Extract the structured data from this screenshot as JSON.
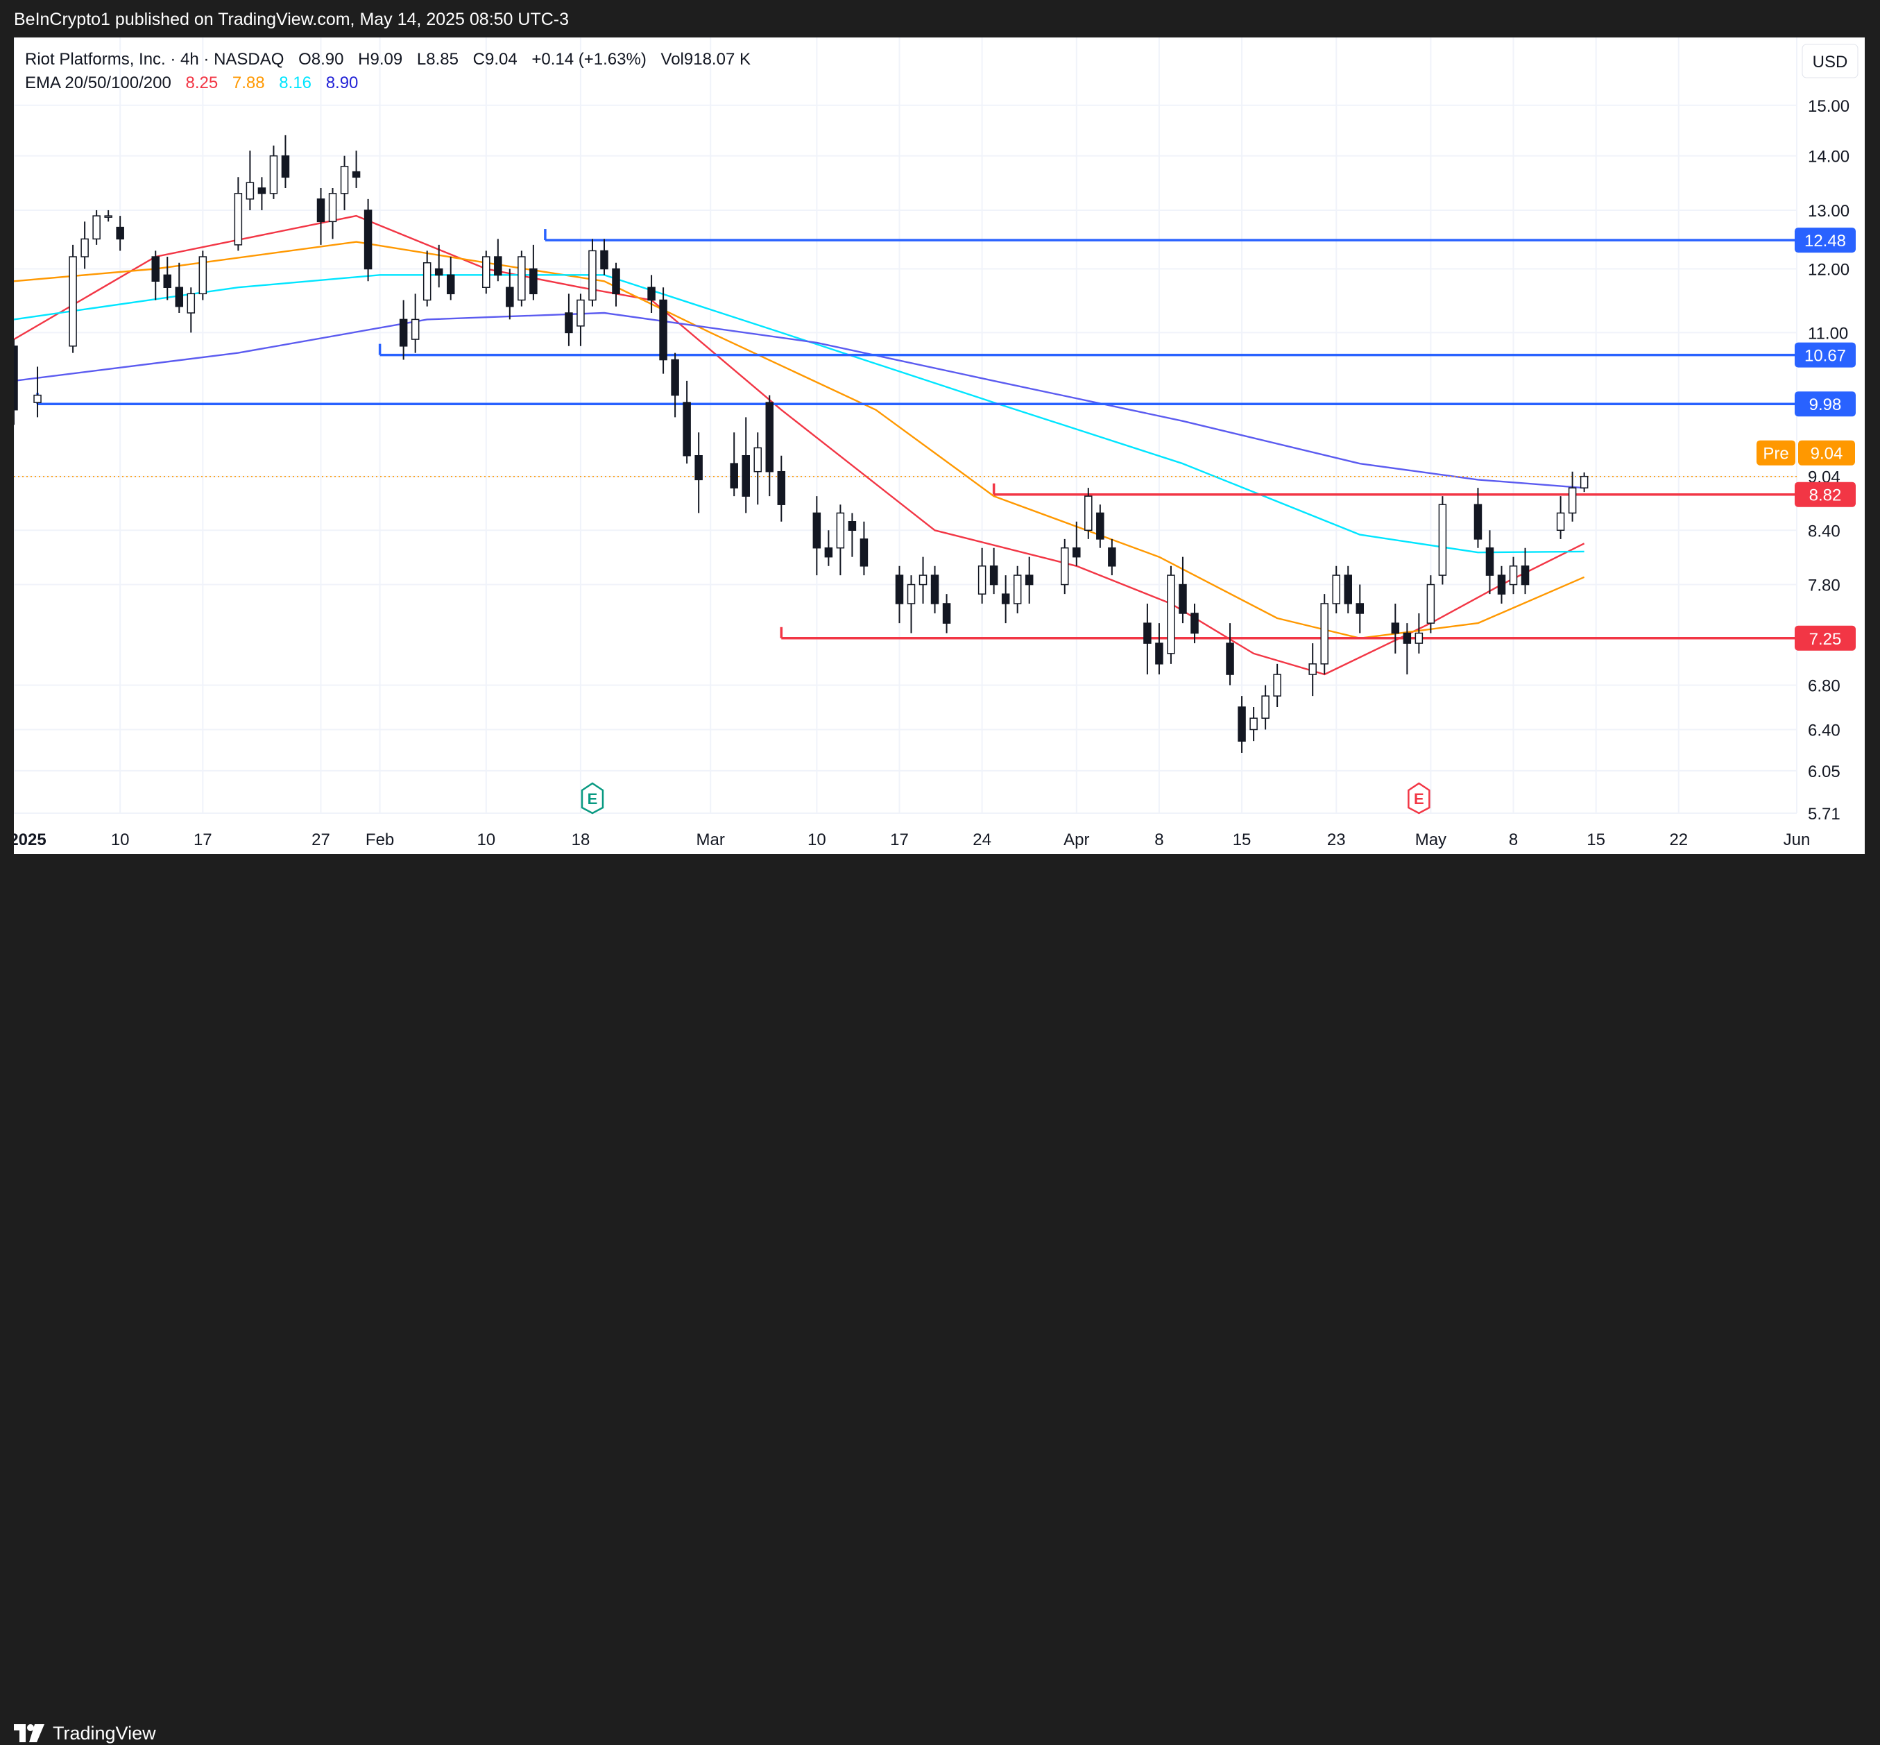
{
  "header": {
    "publisher": "BeInCrypto1 published on TradingView.com, May 14, 2025 08:50 UTC-3"
  },
  "footer": {
    "brand": "TradingView"
  },
  "chart_data": {
    "type": "candlestick",
    "symbol": {
      "name": "Riot Platforms, Inc. · 4h · NASDAQ",
      "open_label": "O",
      "open": "8.90",
      "high_label": "H",
      "high": "9.09",
      "low_label": "L",
      "low": "8.85",
      "close_label": "C",
      "close": "9.04",
      "change": "+0.14 (+1.63%)",
      "volume_label": "Vol",
      "volume": "918.07 K"
    },
    "ema_legend": {
      "label": "EMA 20/50/100/200",
      "values": [
        {
          "value": "8.25",
          "color": "#f23645"
        },
        {
          "value": "7.88",
          "color": "#ff9800"
        },
        {
          "value": "8.16",
          "color": "#00e5ff"
        },
        {
          "value": "8.90",
          "color": "#2323d6"
        }
      ]
    },
    "currency": "USD",
    "y_ticks": [
      "15.00",
      "14.00",
      "13.00",
      "12.00",
      "11.00",
      "9.04",
      "8.40",
      "7.80",
      "6.80",
      "6.40",
      "6.05",
      "5.71"
    ],
    "x_ticks": [
      "2025",
      "10",
      "17",
      "27",
      "Feb",
      "10",
      "18",
      "Mar",
      "10",
      "17",
      "24",
      "Apr",
      "8",
      "15",
      "23",
      "May",
      "8",
      "15",
      "22",
      "Jun"
    ],
    "x_range": [
      "2025-01-01",
      "2025-06-01"
    ],
    "y_range": [
      5.71,
      15.4
    ],
    "y_scale": "log",
    "pre_market": {
      "label": "Pre",
      "value": "9.04",
      "color": "#ff9800"
    },
    "levels": [
      {
        "value": 12.48,
        "label": "12.48",
        "color": "#2962ff",
        "from": "2025-02-15"
      },
      {
        "value": 10.67,
        "label": "10.67",
        "color": "#2962ff",
        "from": "2025-02-01"
      },
      {
        "value": 9.98,
        "label": "9.98",
        "color": "#2962ff",
        "from": "2025-01-03"
      },
      {
        "value": 8.82,
        "label": "8.82",
        "color": "#f23645",
        "from": "2025-03-25"
      },
      {
        "value": 7.25,
        "label": "7.25",
        "color": "#f23645",
        "from": "2025-03-07"
      }
    ],
    "earnings_markers": [
      {
        "date": "2025-02-19",
        "label": "E",
        "color": "#089981"
      },
      {
        "date": "2025-04-30",
        "label": "E",
        "color": "#f23645"
      }
    ],
    "candles": [
      {
        "d": "2025-01-01",
        "o": 10.8,
        "h": 10.9,
        "l": 9.7,
        "c": 9.9
      },
      {
        "d": "2025-01-03",
        "o": 10.0,
        "h": 10.5,
        "l": 9.8,
        "c": 10.1
      },
      {
        "d": "2025-01-06",
        "o": 10.8,
        "h": 12.4,
        "l": 10.7,
        "c": 12.2
      },
      {
        "d": "2025-01-07",
        "o": 12.2,
        "h": 12.8,
        "l": 12.0,
        "c": 12.5
      },
      {
        "d": "2025-01-08",
        "o": 12.5,
        "h": 13.0,
        "l": 12.4,
        "c": 12.9
      },
      {
        "d": "2025-01-09",
        "o": 12.9,
        "h": 13.0,
        "l": 12.8,
        "c": 12.9
      },
      {
        "d": "2025-01-10",
        "o": 12.7,
        "h": 12.9,
        "l": 12.3,
        "c": 12.5
      },
      {
        "d": "2025-01-13",
        "o": 12.2,
        "h": 12.3,
        "l": 11.5,
        "c": 11.8
      },
      {
        "d": "2025-01-14",
        "o": 11.9,
        "h": 12.2,
        "l": 11.5,
        "c": 11.7
      },
      {
        "d": "2025-01-15",
        "o": 11.7,
        "h": 12.1,
        "l": 11.3,
        "c": 11.4
      },
      {
        "d": "2025-01-16",
        "o": 11.3,
        "h": 11.7,
        "l": 11.0,
        "c": 11.6
      },
      {
        "d": "2025-01-17",
        "o": 11.6,
        "h": 12.3,
        "l": 11.5,
        "c": 12.2
      },
      {
        "d": "2025-01-20",
        "o": 12.4,
        "h": 13.6,
        "l": 12.3,
        "c": 13.3
      },
      {
        "d": "2025-01-21",
        "o": 13.2,
        "h": 14.1,
        "l": 13.0,
        "c": 13.5
      },
      {
        "d": "2025-01-22",
        "o": 13.4,
        "h": 13.6,
        "l": 13.0,
        "c": 13.3
      },
      {
        "d": "2025-01-23",
        "o": 13.3,
        "h": 14.2,
        "l": 13.2,
        "c": 14.0
      },
      {
        "d": "2025-01-24",
        "o": 14.0,
        "h": 14.4,
        "l": 13.4,
        "c": 13.6
      },
      {
        "d": "2025-01-27",
        "o": 13.2,
        "h": 13.4,
        "l": 12.4,
        "c": 12.8
      },
      {
        "d": "2025-01-28",
        "o": 12.8,
        "h": 13.4,
        "l": 12.5,
        "c": 13.3
      },
      {
        "d": "2025-01-29",
        "o": 13.3,
        "h": 14.0,
        "l": 13.0,
        "c": 13.8
      },
      {
        "d": "2025-01-30",
        "o": 13.7,
        "h": 14.1,
        "l": 13.4,
        "c": 13.6
      },
      {
        "d": "2025-01-31",
        "o": 13.0,
        "h": 13.2,
        "l": 11.8,
        "c": 12.0
      },
      {
        "d": "2025-02-03",
        "o": 11.2,
        "h": 11.5,
        "l": 10.6,
        "c": 10.8
      },
      {
        "d": "2025-02-04",
        "o": 10.9,
        "h": 11.6,
        "l": 10.7,
        "c": 11.2
      },
      {
        "d": "2025-02-05",
        "o": 11.5,
        "h": 12.3,
        "l": 11.4,
        "c": 12.1
      },
      {
        "d": "2025-02-06",
        "o": 12.0,
        "h": 12.4,
        "l": 11.7,
        "c": 11.9
      },
      {
        "d": "2025-02-07",
        "o": 11.9,
        "h": 12.2,
        "l": 11.5,
        "c": 11.6
      },
      {
        "d": "2025-02-10",
        "o": 11.7,
        "h": 12.3,
        "l": 11.6,
        "c": 12.2
      },
      {
        "d": "2025-02-11",
        "o": 12.2,
        "h": 12.5,
        "l": 11.8,
        "c": 11.9
      },
      {
        "d": "2025-02-12",
        "o": 11.7,
        "h": 12.0,
        "l": 11.2,
        "c": 11.4
      },
      {
        "d": "2025-02-13",
        "o": 11.5,
        "h": 12.3,
        "l": 11.4,
        "c": 12.2
      },
      {
        "d": "2025-02-14",
        "o": 12.0,
        "h": 12.4,
        "l": 11.5,
        "c": 11.6
      },
      {
        "d": "2025-02-17",
        "o": 11.3,
        "h": 11.6,
        "l": 10.8,
        "c": 11.0
      },
      {
        "d": "2025-02-18",
        "o": 11.1,
        "h": 11.6,
        "l": 10.8,
        "c": 11.5
      },
      {
        "d": "2025-02-19",
        "o": 11.5,
        "h": 12.5,
        "l": 11.4,
        "c": 12.3
      },
      {
        "d": "2025-02-20",
        "o": 12.3,
        "h": 12.5,
        "l": 11.9,
        "c": 12.0
      },
      {
        "d": "2025-02-21",
        "o": 12.0,
        "h": 12.1,
        "l": 11.4,
        "c": 11.6
      },
      {
        "d": "2025-02-24",
        "o": 11.7,
        "h": 11.9,
        "l": 11.3,
        "c": 11.5
      },
      {
        "d": "2025-02-25",
        "o": 11.5,
        "h": 11.7,
        "l": 10.4,
        "c": 10.6
      },
      {
        "d": "2025-02-26",
        "o": 10.6,
        "h": 10.7,
        "l": 9.8,
        "c": 10.1
      },
      {
        "d": "2025-02-27",
        "o": 10.0,
        "h": 10.3,
        "l": 9.2,
        "c": 9.3
      },
      {
        "d": "2025-02-28",
        "o": 9.3,
        "h": 9.6,
        "l": 8.6,
        "c": 9.0
      },
      {
        "d": "2025-03-03",
        "o": 9.2,
        "h": 9.6,
        "l": 8.8,
        "c": 8.9
      },
      {
        "d": "2025-03-04",
        "o": 9.3,
        "h": 9.8,
        "l": 8.6,
        "c": 8.8
      },
      {
        "d": "2025-03-05",
        "o": 9.1,
        "h": 9.6,
        "l": 8.7,
        "c": 9.4
      },
      {
        "d": "2025-03-06",
        "o": 10.0,
        "h": 10.1,
        "l": 8.8,
        "c": 9.1
      },
      {
        "d": "2025-03-07",
        "o": 9.1,
        "h": 9.3,
        "l": 8.5,
        "c": 8.7
      },
      {
        "d": "2025-03-10",
        "o": 8.6,
        "h": 8.8,
        "l": 7.9,
        "c": 8.2
      },
      {
        "d": "2025-03-11",
        "o": 8.2,
        "h": 8.4,
        "l": 8.0,
        "c": 8.1
      },
      {
        "d": "2025-03-12",
        "o": 8.2,
        "h": 8.7,
        "l": 7.9,
        "c": 8.6
      },
      {
        "d": "2025-03-13",
        "o": 8.5,
        "h": 8.6,
        "l": 8.1,
        "c": 8.4
      },
      {
        "d": "2025-03-14",
        "o": 8.3,
        "h": 8.5,
        "l": 7.9,
        "c": 8.0
      },
      {
        "d": "2025-03-17",
        "o": 7.9,
        "h": 8.0,
        "l": 7.4,
        "c": 7.6
      },
      {
        "d": "2025-03-18",
        "o": 7.6,
        "h": 7.9,
        "l": 7.3,
        "c": 7.8
      },
      {
        "d": "2025-03-19",
        "o": 7.8,
        "h": 8.1,
        "l": 7.6,
        "c": 7.9
      },
      {
        "d": "2025-03-20",
        "o": 7.9,
        "h": 8.0,
        "l": 7.5,
        "c": 7.6
      },
      {
        "d": "2025-03-21",
        "o": 7.6,
        "h": 7.7,
        "l": 7.3,
        "c": 7.4
      },
      {
        "d": "2025-03-24",
        "o": 7.7,
        "h": 8.2,
        "l": 7.6,
        "c": 8.0
      },
      {
        "d": "2025-03-25",
        "o": 8.0,
        "h": 8.2,
        "l": 7.7,
        "c": 7.8
      },
      {
        "d": "2025-03-26",
        "o": 7.7,
        "h": 7.9,
        "l": 7.4,
        "c": 7.6
      },
      {
        "d": "2025-03-27",
        "o": 7.6,
        "h": 8.0,
        "l": 7.5,
        "c": 7.9
      },
      {
        "d": "2025-03-28",
        "o": 7.9,
        "h": 8.1,
        "l": 7.6,
        "c": 7.8
      },
      {
        "d": "2025-03-31",
        "o": 7.8,
        "h": 8.3,
        "l": 7.7,
        "c": 8.2
      },
      {
        "d": "2025-04-01",
        "o": 8.2,
        "h": 8.5,
        "l": 8.0,
        "c": 8.1
      },
      {
        "d": "2025-04-02",
        "o": 8.4,
        "h": 8.9,
        "l": 8.3,
        "c": 8.8
      },
      {
        "d": "2025-04-03",
        "o": 8.6,
        "h": 8.7,
        "l": 8.2,
        "c": 8.3
      },
      {
        "d": "2025-04-04",
        "o": 8.2,
        "h": 8.3,
        "l": 7.9,
        "c": 8.0
      },
      {
        "d": "2025-04-07",
        "o": 7.4,
        "h": 7.6,
        "l": 6.9,
        "c": 7.2
      },
      {
        "d": "2025-04-08",
        "o": 7.2,
        "h": 7.4,
        "l": 6.9,
        "c": 7.0
      },
      {
        "d": "2025-04-09",
        "o": 7.1,
        "h": 8.0,
        "l": 7.0,
        "c": 7.9
      },
      {
        "d": "2025-04-10",
        "o": 7.8,
        "h": 8.1,
        "l": 7.4,
        "c": 7.5
      },
      {
        "d": "2025-04-11",
        "o": 7.5,
        "h": 7.6,
        "l": 7.2,
        "c": 7.3
      },
      {
        "d": "2025-04-14",
        "o": 7.2,
        "h": 7.4,
        "l": 6.8,
        "c": 6.9
      },
      {
        "d": "2025-04-15",
        "o": 6.6,
        "h": 6.7,
        "l": 6.2,
        "c": 6.3
      },
      {
        "d": "2025-04-16",
        "o": 6.4,
        "h": 6.6,
        "l": 6.3,
        "c": 6.5
      },
      {
        "d": "2025-04-17",
        "o": 6.5,
        "h": 6.8,
        "l": 6.4,
        "c": 6.7
      },
      {
        "d": "2025-04-18",
        "o": 6.7,
        "h": 7.0,
        "l": 6.6,
        "c": 6.9
      },
      {
        "d": "2025-04-21",
        "o": 6.9,
        "h": 7.2,
        "l": 6.7,
        "c": 7.0
      },
      {
        "d": "2025-04-22",
        "o": 7.0,
        "h": 7.7,
        "l": 6.9,
        "c": 7.6
      },
      {
        "d": "2025-04-23",
        "o": 7.6,
        "h": 8.0,
        "l": 7.5,
        "c": 7.9
      },
      {
        "d": "2025-04-24",
        "o": 7.9,
        "h": 8.0,
        "l": 7.5,
        "c": 7.6
      },
      {
        "d": "2025-04-25",
        "o": 7.6,
        "h": 7.8,
        "l": 7.3,
        "c": 7.5
      },
      {
        "d": "2025-04-28",
        "o": 7.4,
        "h": 7.6,
        "l": 7.1,
        "c": 7.3
      },
      {
        "d": "2025-04-29",
        "o": 7.3,
        "h": 7.4,
        "l": 6.9,
        "c": 7.2
      },
      {
        "d": "2025-04-30",
        "o": 7.2,
        "h": 7.5,
        "l": 7.1,
        "c": 7.3
      },
      {
        "d": "2025-05-01",
        "o": 7.4,
        "h": 7.9,
        "l": 7.3,
        "c": 7.8
      },
      {
        "d": "2025-05-02",
        "o": 7.9,
        "h": 8.8,
        "l": 7.8,
        "c": 8.7
      },
      {
        "d": "2025-05-05",
        "o": 8.7,
        "h": 8.9,
        "l": 8.2,
        "c": 8.3
      },
      {
        "d": "2025-05-06",
        "o": 8.2,
        "h": 8.4,
        "l": 7.7,
        "c": 7.9
      },
      {
        "d": "2025-05-07",
        "o": 7.9,
        "h": 8.0,
        "l": 7.6,
        "c": 7.7
      },
      {
        "d": "2025-05-08",
        "o": 7.8,
        "h": 8.1,
        "l": 7.7,
        "c": 8.0
      },
      {
        "d": "2025-05-09",
        "o": 8.0,
        "h": 8.2,
        "l": 7.7,
        "c": 7.8
      },
      {
        "d": "2025-05-12",
        "o": 8.4,
        "h": 8.8,
        "l": 8.3,
        "c": 8.6
      },
      {
        "d": "2025-05-13",
        "o": 8.6,
        "h": 9.1,
        "l": 8.5,
        "c": 8.9
      },
      {
        "d": "2025-05-14",
        "o": 8.9,
        "h": 9.09,
        "l": 8.85,
        "c": 9.04
      }
    ],
    "ema_series": [
      {
        "name": "EMA 20",
        "color": "#f23645",
        "points": [
          [
            "2025-01-01",
            10.9
          ],
          [
            "2025-01-13",
            12.2
          ],
          [
            "2025-01-30",
            12.9
          ],
          [
            "2025-02-10",
            12.0
          ],
          [
            "2025-02-18",
            11.7
          ],
          [
            "2025-02-24",
            11.5
          ],
          [
            "2025-03-07",
            9.9
          ],
          [
            "2025-03-20",
            8.4
          ],
          [
            "2025-04-01",
            8.0
          ],
          [
            "2025-04-09",
            7.6
          ],
          [
            "2025-04-16",
            7.1
          ],
          [
            "2025-04-22",
            6.9
          ],
          [
            "2025-05-01",
            7.4
          ],
          [
            "2025-05-07",
            7.8
          ],
          [
            "2025-05-14",
            8.25
          ]
        ]
      },
      {
        "name": "EMA 50",
        "color": "#ff9800",
        "points": [
          [
            "2025-01-01",
            11.8
          ],
          [
            "2025-01-13",
            12.0
          ],
          [
            "2025-01-30",
            12.45
          ],
          [
            "2025-02-10",
            12.1
          ],
          [
            "2025-02-20",
            11.8
          ],
          [
            "2025-03-01",
            11.0
          ],
          [
            "2025-03-15",
            9.9
          ],
          [
            "2025-03-25",
            8.8
          ],
          [
            "2025-04-08",
            8.1
          ],
          [
            "2025-04-18",
            7.45
          ],
          [
            "2025-04-25",
            7.25
          ],
          [
            "2025-05-05",
            7.4
          ],
          [
            "2025-05-14",
            7.88
          ]
        ]
      },
      {
        "name": "EMA 100",
        "color": "#00e5ff",
        "points": [
          [
            "2025-01-01",
            11.2
          ],
          [
            "2025-01-20",
            11.7
          ],
          [
            "2025-02-01",
            11.9
          ],
          [
            "2025-02-20",
            11.9
          ],
          [
            "2025-03-07",
            11.0
          ],
          [
            "2025-03-25",
            10.0
          ],
          [
            "2025-04-10",
            9.2
          ],
          [
            "2025-04-25",
            8.35
          ],
          [
            "2025-05-05",
            8.15
          ],
          [
            "2025-05-14",
            8.16
          ]
        ]
      },
      {
        "name": "EMA 200",
        "color": "#5b5bf0",
        "points": [
          [
            "2025-01-01",
            10.3
          ],
          [
            "2025-01-20",
            10.7
          ],
          [
            "2025-02-05",
            11.2
          ],
          [
            "2025-02-20",
            11.3
          ],
          [
            "2025-03-10",
            10.85
          ],
          [
            "2025-03-25",
            10.3
          ],
          [
            "2025-04-10",
            9.75
          ],
          [
            "2025-04-25",
            9.2
          ],
          [
            "2025-05-05",
            9.0
          ],
          [
            "2025-05-14",
            8.9
          ]
        ]
      }
    ]
  }
}
